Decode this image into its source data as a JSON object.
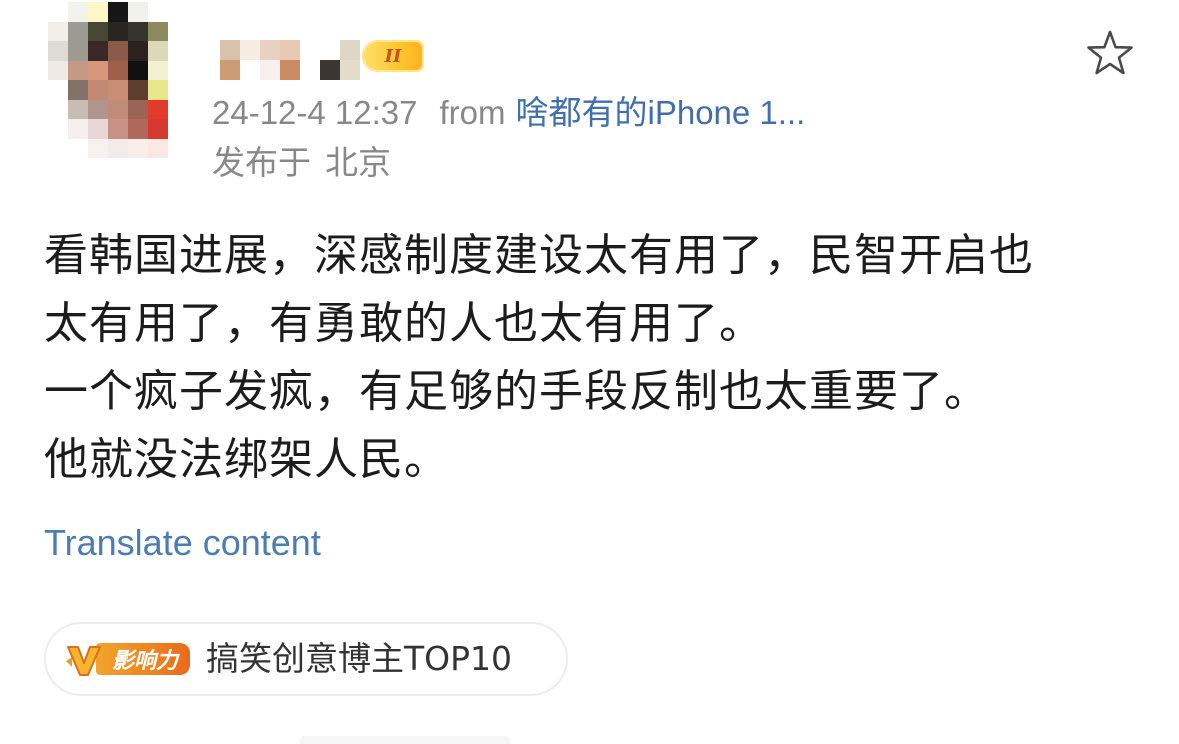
{
  "header": {
    "vip_level": "II",
    "timestamp": "24-12-4 12:37",
    "from_label": "from",
    "source": "啥都有的iPhone 1...",
    "location_prefix": "发布于",
    "location": "北京",
    "star_icon": "star-outline-icon"
  },
  "post": {
    "lines": [
      "看韩国进展，深感制度建设太有用了，民智开启也",
      "太有用了，有勇敢的人也太有用了。",
      "一个疯子发疯，有足够的手段反制也太重要了。",
      "他就没法绑架人民。"
    ],
    "translate_label": "Translate content"
  },
  "tag": {
    "badge_letter": "V",
    "badge_label": "影响力",
    "text": "搞笑创意博主TOP10"
  },
  "colors": {
    "link": "#3f6fae",
    "meta": "#888888",
    "vip_gold": "#ffc531",
    "badge_orange": "#ea6b1a"
  }
}
